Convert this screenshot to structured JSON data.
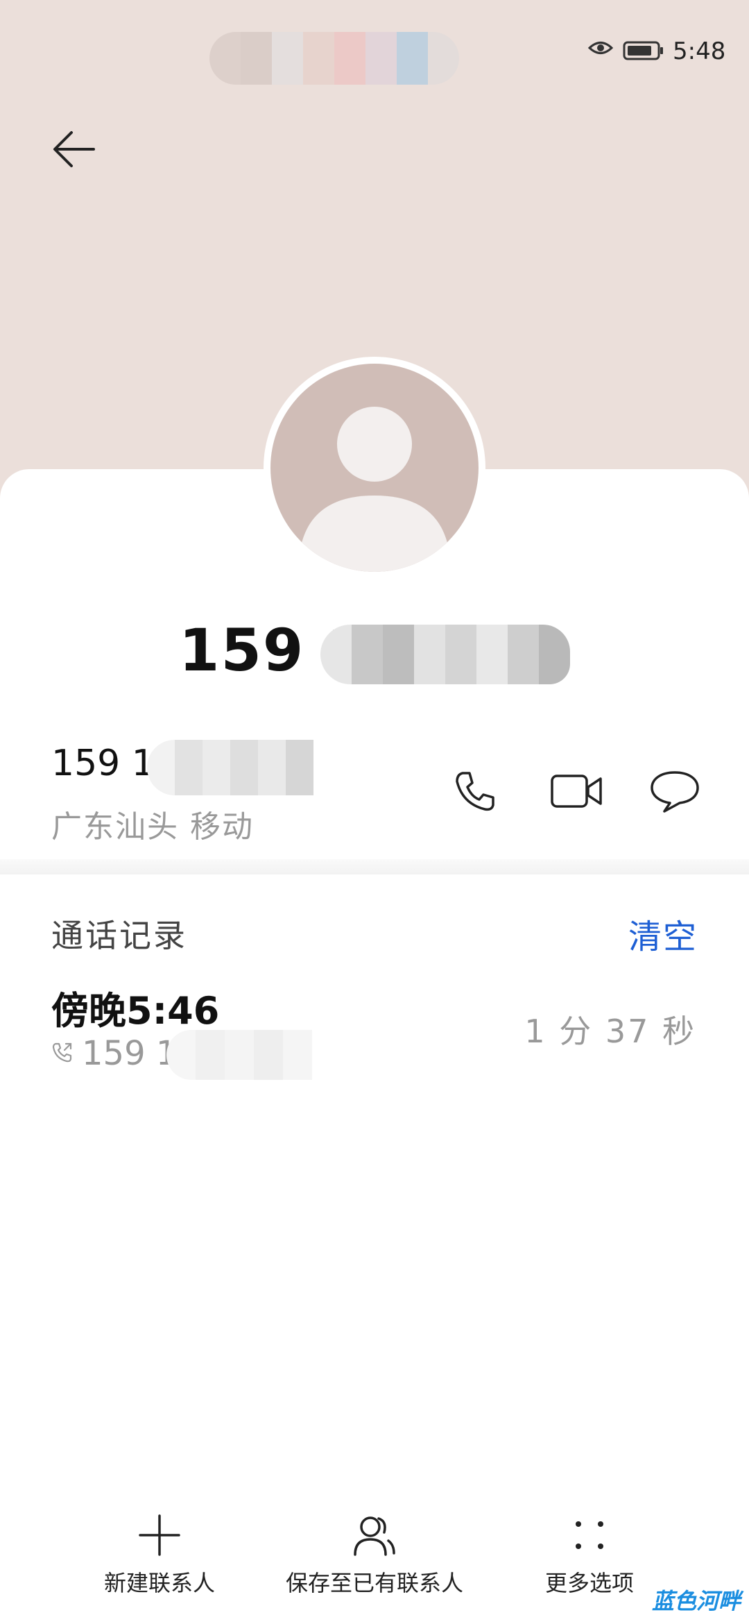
{
  "status_bar": {
    "time": "5:48",
    "eye_icon": "eye-icon",
    "battery_icon": "battery-icon"
  },
  "header": {
    "back_icon": "arrow-left-icon"
  },
  "contact": {
    "title_number": "159 1",
    "number": "159 1",
    "location": "广东汕头 移动"
  },
  "actions": {
    "call_icon": "phone-icon",
    "video_icon": "video-camera-icon",
    "message_icon": "chat-bubble-icon"
  },
  "call_log": {
    "title": "通话记录",
    "clear_label": "清空",
    "entries": [
      {
        "time": "傍晚5:46",
        "number": "159 1",
        "duration": "1 分 37 秒",
        "icon": "outgoing-call-icon"
      }
    ]
  },
  "bottom_bar": {
    "items": [
      {
        "label": "新建联系人",
        "icon": "plus-icon"
      },
      {
        "label": "保存至已有联系人",
        "icon": "contacts-icon"
      },
      {
        "label": "更多选项",
        "icon": "more-dots-icon"
      }
    ]
  },
  "watermark": "蓝色河畔",
  "colors": {
    "accent": "#1e5fd4",
    "header_bg": "#ebdfda",
    "avatar_bg": "#d0bdb7"
  }
}
